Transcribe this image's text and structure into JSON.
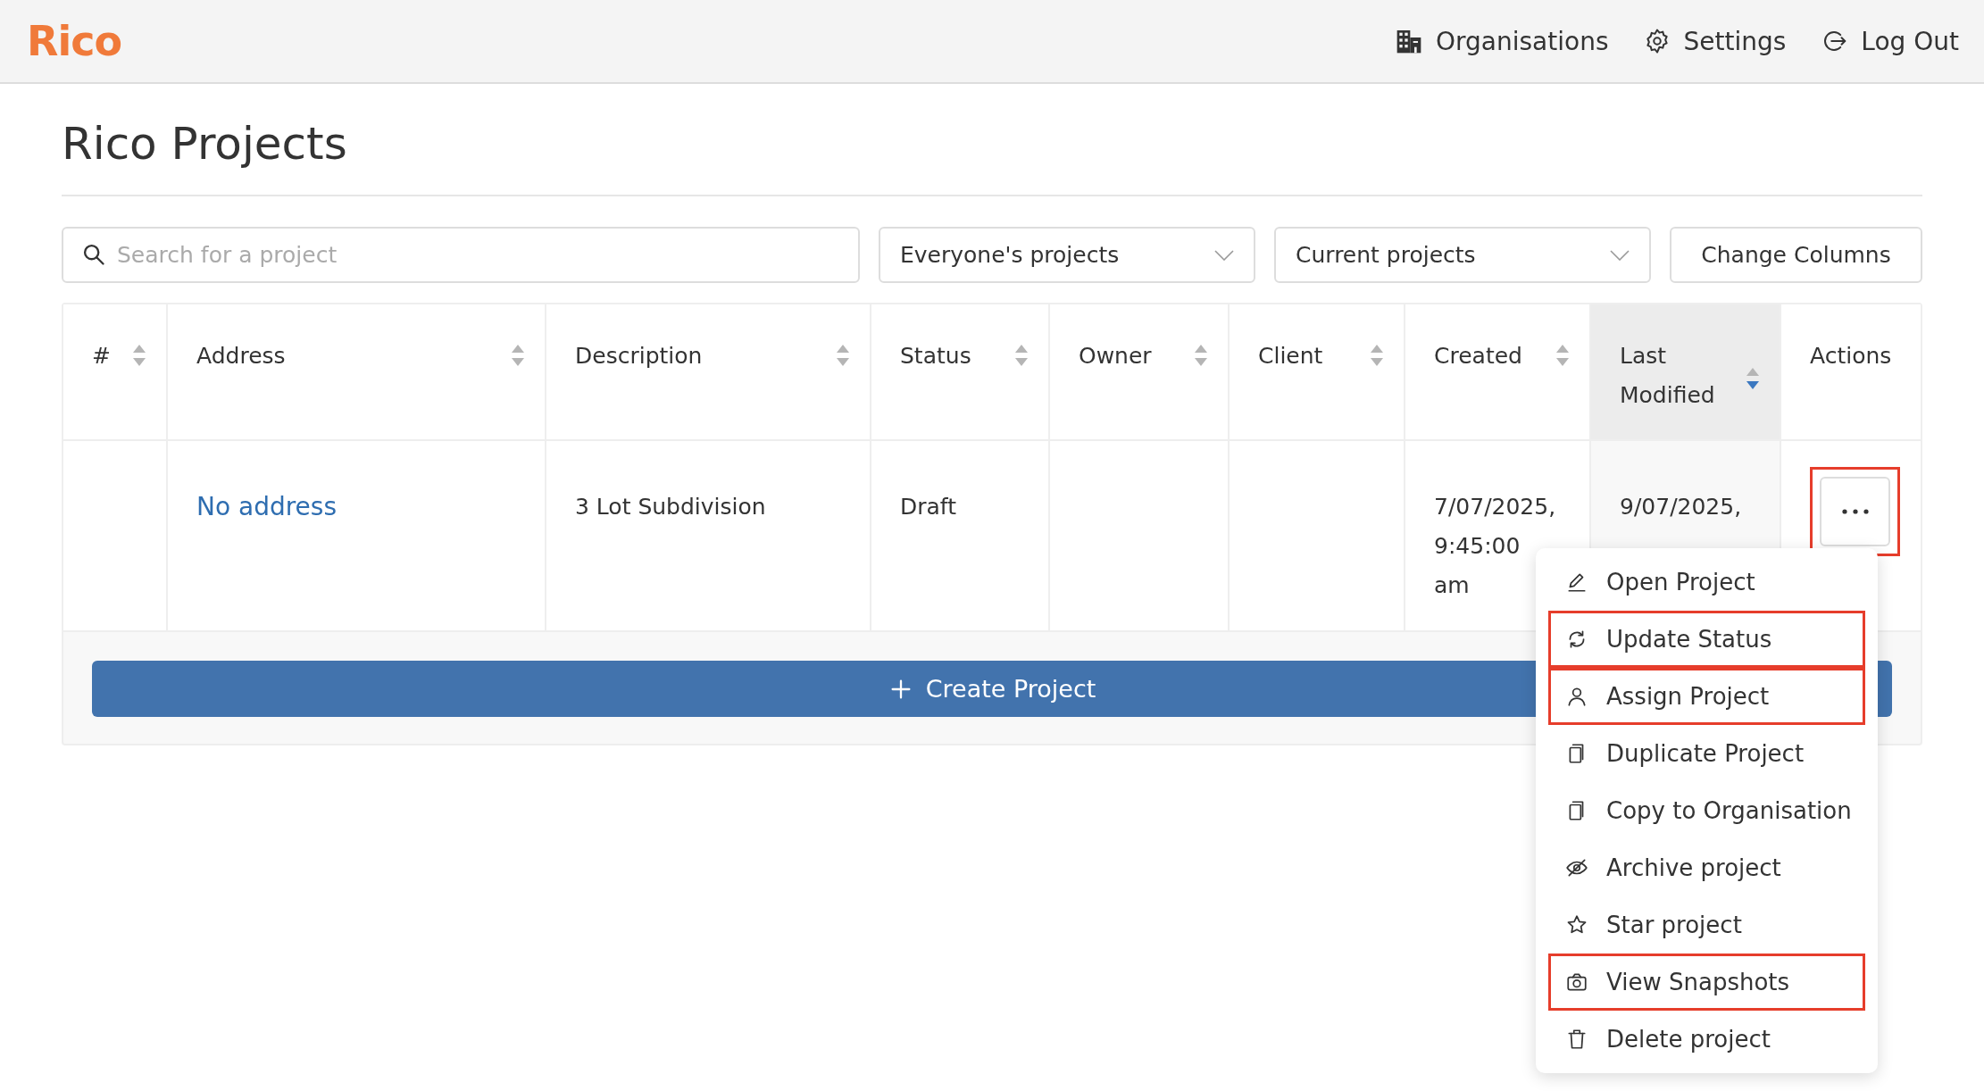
{
  "header": {
    "logo": "Rico",
    "nav": [
      {
        "label": "Organisations"
      },
      {
        "label": "Settings"
      },
      {
        "label": "Log Out"
      }
    ]
  },
  "title": "Rico Projects",
  "toolbar": {
    "search": {
      "placeholder": "Search for a project"
    },
    "filters": [
      {
        "value": "Everyone's projects"
      },
      {
        "value": "Current projects"
      }
    ],
    "button": "Change Columns"
  },
  "table": {
    "columns": [
      {
        "label": "#",
        "sortable": true,
        "sorted": false
      },
      {
        "label": "Address",
        "sortable": true,
        "sorted": false
      },
      {
        "label": "Description",
        "sortable": true,
        "sorted": false
      },
      {
        "label": "Status",
        "sortable": true,
        "sorted": false
      },
      {
        "label": "Owner",
        "sortable": true,
        "sorted": false
      },
      {
        "label": "Client",
        "sortable": true,
        "sorted": false
      },
      {
        "label": "Created",
        "sortable": true,
        "sorted": false
      },
      {
        "label": "Last Modified",
        "sortable": true,
        "sorted": true
      },
      {
        "label": "Actions",
        "sortable": false,
        "sorted": false
      }
    ],
    "rows": [
      {
        "address": "No address",
        "description": "3 Lot Subdivision",
        "status": "Draft",
        "created": "7/07/2025, 9:45:00 am",
        "last_modified": "9/07/2025,",
        "actions_highlighted": true
      }
    ],
    "create_button": "Create Project"
  },
  "menu": {
    "items": [
      {
        "label": "Open Project",
        "highlighted": false
      },
      {
        "label": "Update Status",
        "highlighted": true
      },
      {
        "label": "Assign Project",
        "highlighted": true
      },
      {
        "label": "Duplicate Project",
        "highlighted": false
      },
      {
        "label": "Copy to Organisation",
        "highlighted": false
      },
      {
        "label": "Archive project",
        "highlighted": false
      },
      {
        "label": "Star project",
        "highlighted": false
      },
      {
        "label": "View Snapshots",
        "highlighted": true
      },
      {
        "label": "Delete project",
        "highlighted": false
      }
    ]
  }
}
